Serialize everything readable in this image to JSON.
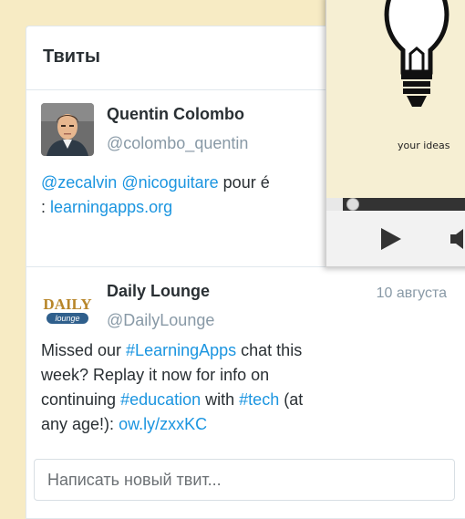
{
  "header": {
    "title": "Твиты"
  },
  "tweets": [
    {
      "name": "Quentin Colombo",
      "handle": "@colombo_quentin",
      "text_parts": [
        "@zecalvin",
        " ",
        "@nicoguitare",
        " pour é\n: ",
        "learningapps.org"
      ]
    },
    {
      "name": "Daily Lounge",
      "handle": "@DailyLounge",
      "date": "10 августа",
      "avatar_logo_top": "DAILY",
      "avatar_logo_bottom": "lounge",
      "text_parts": [
        "Missed our ",
        "#LearningApps",
        " chat this\nweek? Replay it now for info on\ncontinuing ",
        "#education",
        " with ",
        "#tech",
        " (at\nany age!): ",
        "ow.ly/zxxKC"
      ]
    }
  ],
  "compose": {
    "placeholder": "Написать новый твит..."
  },
  "video": {
    "caption": "your ideas"
  },
  "colors": {
    "link": "#1b95e0",
    "background": "#f7ebc4",
    "name": "#292f33",
    "muted": "#8899a6"
  }
}
